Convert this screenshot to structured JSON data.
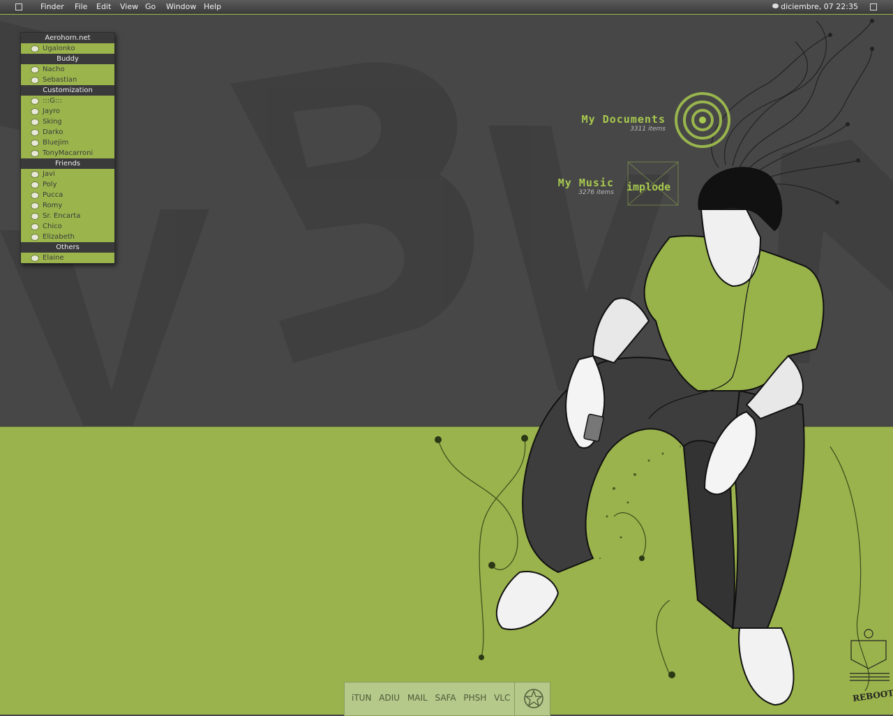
{
  "menubar": {
    "menus": [
      "Finder",
      "File",
      "Edit",
      "View",
      "Go",
      "Window",
      "Help"
    ],
    "datetime": "diciembre, 07  22:35"
  },
  "buddylist": {
    "groups": [
      {
        "name": "Aerohorn.net",
        "buddies": [
          "Ugalonko"
        ]
      },
      {
        "name": "Buddy",
        "buddies": [
          "Nacho",
          "Sebastian"
        ]
      },
      {
        "name": "Customization",
        "buddies": [
          ":::G:::",
          "Jayro",
          "Sking",
          "Darko",
          "Bluejim",
          "TonyMacarroni"
        ]
      },
      {
        "name": "Friends",
        "buddies": [
          "Javi",
          "Poly",
          "Pucca",
          "Romy",
          "Sr. Encarta",
          "Chico",
          "Elizabeth"
        ]
      },
      {
        "name": "Others",
        "buddies": [
          "Elaine"
        ]
      }
    ]
  },
  "desktop": {
    "documents": {
      "name": "My Documents",
      "count": "3311 items"
    },
    "music": {
      "name": "My Music",
      "count": "3276 items"
    },
    "music_badge": "implode",
    "corner_badge": "REBOOT"
  },
  "dock": {
    "items": [
      "iTUN",
      "ADIU",
      "MAIL",
      "SAFA",
      "PHSH",
      "VLC"
    ]
  },
  "colors": {
    "accent_green": "#9bb54c",
    "dark_bg": "#474747",
    "ground_green": "#9bb34c"
  }
}
